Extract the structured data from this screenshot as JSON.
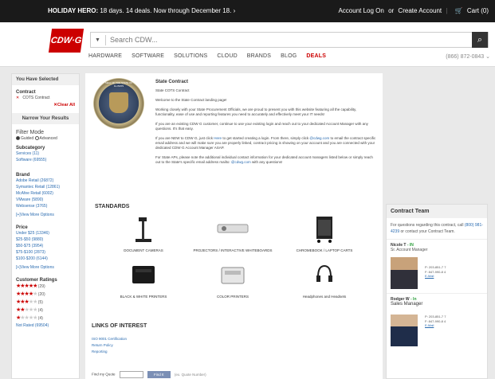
{
  "topbar": {
    "promo_bold": "HOLIDAY HERO:",
    "promo_text": "18 days. 14 deals. Now through December 18.",
    "promo_arrow": "›",
    "account_log_on": "Account Log On",
    "or_text": "or",
    "create_account": "Create Account",
    "cart_label": "Cart (0)"
  },
  "header": {
    "logo_text": "CDW·G",
    "search_placeholder": "Search CDW...",
    "nav": [
      "HARDWARE",
      "SOFTWARE",
      "SOLUTIONS",
      "CLOUD",
      "BRANDS",
      "BLOG",
      "DEALS"
    ],
    "phone": "(866) 872-0843"
  },
  "sidebar": {
    "you_have_selected": "You Have Selected",
    "contract_label": "Contract",
    "contract_value": "COTS Contract",
    "clear_all": "✕Clear All",
    "narrow_results": "Narrow Your Results",
    "filter_mode": "Filter Mode",
    "guided": "Guided",
    "advanced": "Advanced",
    "subcategory_title": "Subcategory",
    "subcategories": [
      "Services (11)",
      "Software (69555)"
    ],
    "brand_title": "Brand",
    "brands": [
      "Adobe Retail (26872)",
      "Symantec Retail (12861)",
      "McAfee Retail (6002)",
      "VMware (5890)",
      "Websense (3765)"
    ],
    "view_more_brand": "[+]View More Options",
    "price_title": "Price",
    "prices": [
      "Under $25 (13346)",
      "$25-$50 (9880)",
      "$50-$75 (3954)",
      "$75-$100 (2873)",
      "$100-$200 (6144)"
    ],
    "view_more_price": "[+]View More Options",
    "ratings_title": "Customer Ratings",
    "ratings": [
      {
        "stars": 5,
        "count": "(29)"
      },
      {
        "stars": 4,
        "count": "(20)"
      },
      {
        "stars": 3,
        "count": "(5)"
      },
      {
        "stars": 2,
        "count": "(4)"
      },
      {
        "stars": 1,
        "count": "(4)"
      }
    ],
    "not_rated": "Not Rated (69504)"
  },
  "main": {
    "seal_text": "SEAL OF THE STATE OF ILLINOIS",
    "heading": "State Contract",
    "state_cots": "State COTS Contract",
    "welcome": "Welcome to the State  Contract landing page!",
    "para1": "Working closely with your State Procurement Officials, we are proud to present you with this website featuring all the capability, functionality, ease of use and reporting features you need to accurately and effectively meet your IT needs!",
    "para2": "If you are an existing CDW·G customer, continue to use your existing login and reach out to your dedicated Account Manager with any questions. It's that easy.",
    "para3_a": "If you are NEW to CDW·G, just click",
    "para3_here": "Here",
    "para3_b": "to get started creating a login. From there, simply click",
    "para3_email": "@cdwg.com",
    "para3_c": "to email the contract specific email address and we will make sure you are properly linked, contract pricing is showing on your account and you are connected with your dedicated CDW·G Account Manager ASAP.",
    "para4_a": "For State               APs, please note the additional individual contact information for your dedicated account managers listed below or simply reach out to the State's specific email address mailto:",
    "para4_email": "@cdwg.com",
    "para4_b": "with any questions!",
    "standards_title": "STANDARDS",
    "products": [
      "DOCUMENT CAMERAS",
      "PROJECTORS / INTERACTIVE WHITEBOARDS",
      "CHROMEBOOK / LAPTOP CARTS",
      "BLACK & WHITE PRINTERS",
      "COLOR PRINTERS",
      "Headphones and Headsets"
    ],
    "links_title": "LINKS OF INTEREST",
    "links": [
      "ISO 9001 Certification",
      "Return Policy",
      "Reporting"
    ],
    "find_quote": "Find my Quote",
    "find_btn": "Find It",
    "quote_hint": "(ex. Quote Number)"
  },
  "contract_team": {
    "title": "Contract Team",
    "intro_a": "For questions regarding this contract, call",
    "intro_phone": "(800) 981-4239",
    "intro_b": "or contact your Contract Team.",
    "contacts": [
      {
        "name": "Nicole T",
        "status": "- IN",
        "role": "Sr. Account Manager",
        "p": "P: 203-851-7   7",
        "f": "F: 847-990-8   4",
        "email": "E-Mail"
      },
      {
        "name": "Rodger W",
        "status": "- In",
        "role": "Sales Manager",
        "p": "P: 203-851-7   7",
        "f": "F: 847-990-8   4",
        "email": "E-Mail"
      }
    ]
  },
  "colors": {
    "accent": "#cc0000",
    "link": "#2a6bb0",
    "topbar": "#1a1a1a"
  }
}
